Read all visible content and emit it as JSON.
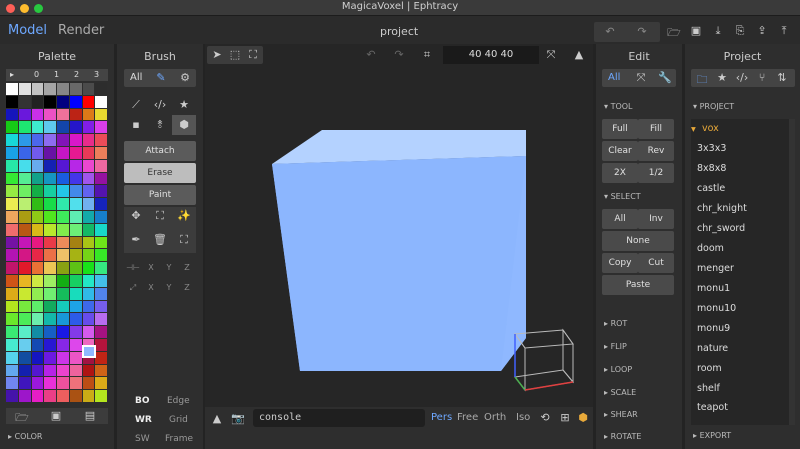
{
  "window": {
    "title": "MagicaVoxel | Ephtracy",
    "project_name": "project"
  },
  "mode_tabs": {
    "model": "Model",
    "render": "Render"
  },
  "palette": {
    "title": "Palette",
    "pages": [
      "▸",
      "0",
      "1",
      "2",
      "3"
    ],
    "footer": "COLOR"
  },
  "brush": {
    "title": "Brush",
    "all_label": "All",
    "modes": {
      "attach": "Attach",
      "erase": "Erase",
      "paint": "Paint"
    },
    "axes": [
      "X",
      "Y",
      "Z",
      "X",
      "Y",
      "Z"
    ],
    "view_options": {
      "bo": "BO",
      "edge": "Edge",
      "wr": "WR",
      "grid": "Grid",
      "sw": "SW",
      "frame": "Frame"
    }
  },
  "viewport": {
    "dimensions": "40  40  40",
    "console": "console",
    "cameras": {
      "pers": "Pers",
      "free": "Free",
      "orth": "Orth",
      "iso": "Iso"
    },
    "voxel_color": "#8fb8ff"
  },
  "edit": {
    "title": "Edit",
    "all_label": "All",
    "tool_header": "TOOL",
    "tool_buttons": {
      "full": "Full",
      "fill": "Fill",
      "clear": "Clear",
      "rev": "Rev",
      "x2": "2X",
      "half": "1/2"
    },
    "select_header": "SELECT",
    "select_buttons": {
      "all": "All",
      "inv": "Inv",
      "none": "None",
      "copy": "Copy",
      "cut": "Cut",
      "paste": "Paste"
    },
    "sections": [
      "ROT",
      "FLIP",
      "LOOP",
      "SCALE",
      "SHEAR",
      "ROTATE"
    ]
  },
  "project": {
    "title": "Project",
    "header": "PROJECT",
    "items": [
      "vox",
      "3x3x3",
      "8x8x8",
      "castle",
      "chr_knight",
      "chr_sword",
      "doom",
      "menger",
      "monu1",
      "monu10",
      "monu9",
      "nature",
      "room",
      "shelf",
      "teapot"
    ],
    "selected": "vox",
    "footer": "EXPORT"
  }
}
